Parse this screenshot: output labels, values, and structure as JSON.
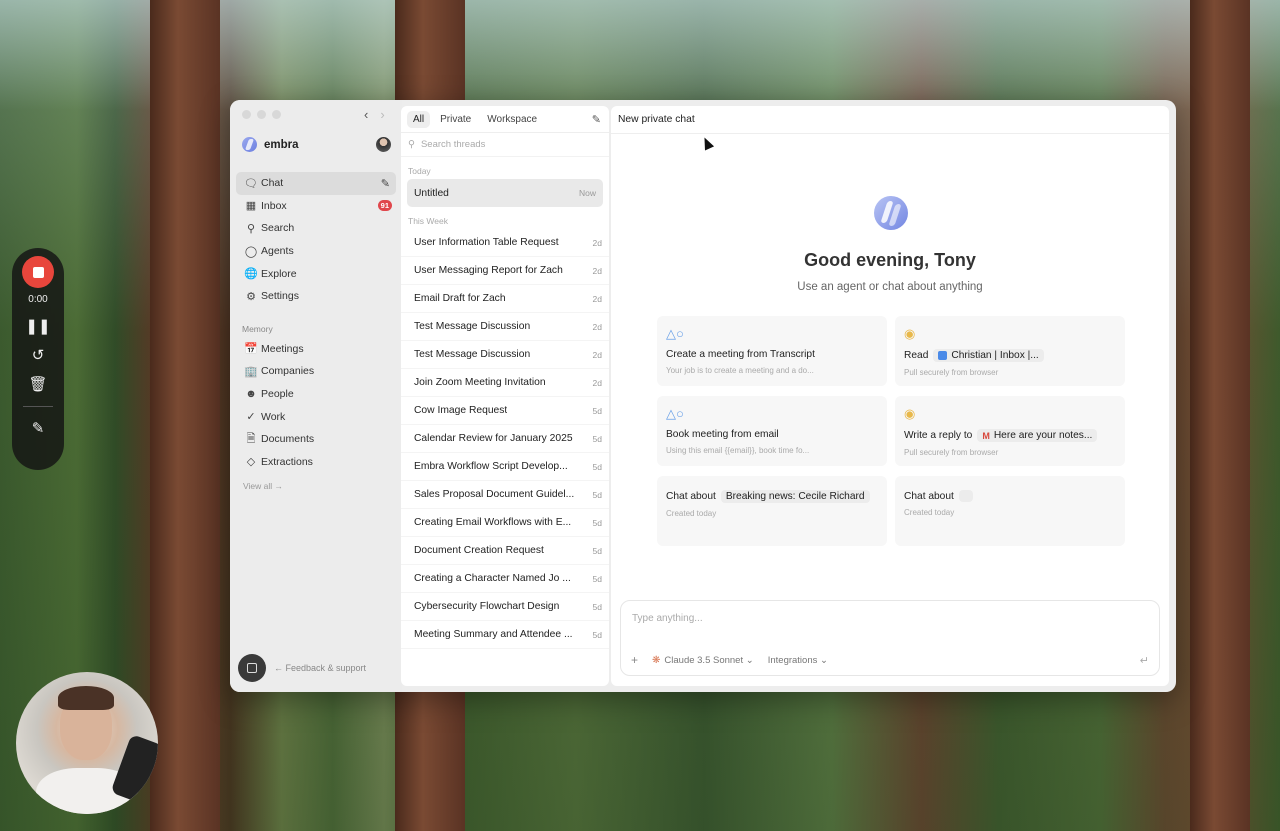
{
  "recorder": {
    "time": "0:00",
    "icons": [
      "stop-icon",
      "pause-icon",
      "restart-icon",
      "trash-icon",
      "pen-icon"
    ]
  },
  "sidebar": {
    "brand": "embra",
    "items": [
      {
        "label": "Chat",
        "icon": "chat-icon"
      },
      {
        "label": "Inbox",
        "icon": "inbox-icon",
        "badge": "91"
      },
      {
        "label": "Search",
        "icon": "search-icon"
      },
      {
        "label": "Agents",
        "icon": "agents-icon"
      },
      {
        "label": "Explore",
        "icon": "globe-icon"
      },
      {
        "label": "Settings",
        "icon": "gear-icon"
      }
    ],
    "memory_label": "Memory",
    "memory_items": [
      {
        "label": "Meetings",
        "icon": "calendar-icon"
      },
      {
        "label": "Companies",
        "icon": "building-icon"
      },
      {
        "label": "People",
        "icon": "person-icon"
      },
      {
        "label": "Work",
        "icon": "check-circle-icon"
      },
      {
        "label": "Documents",
        "icon": "document-icon"
      },
      {
        "label": "Extractions",
        "icon": "diamond-icon"
      }
    ],
    "view_all": "View all →",
    "feedback": "← Feedback & support"
  },
  "threads": {
    "tabs": [
      "All",
      "Private",
      "Workspace"
    ],
    "search_placeholder": "Search threads",
    "today_label": "Today",
    "today": [
      {
        "title": "Untitled",
        "time": "Now"
      }
    ],
    "week_label": "This Week",
    "week": [
      {
        "title": "User Information Table Request",
        "time": "2d"
      },
      {
        "title": "User Messaging Report for Zach",
        "time": "2d"
      },
      {
        "title": "Email Draft for Zach",
        "time": "2d"
      },
      {
        "title": "Test Message Discussion",
        "time": "2d"
      },
      {
        "title": "Test Message Discussion",
        "time": "2d"
      },
      {
        "title": "Join Zoom Meeting Invitation",
        "time": "2d"
      },
      {
        "title": "Cow Image Request",
        "time": "5d"
      },
      {
        "title": "Calendar Review for January 2025",
        "time": "5d"
      },
      {
        "title": "Embra Workflow Script Develop...",
        "time": "5d"
      },
      {
        "title": "Sales Proposal Document Guidel...",
        "time": "5d"
      },
      {
        "title": "Creating Email Workflows with E...",
        "time": "5d"
      },
      {
        "title": "Document Creation Request",
        "time": "5d"
      },
      {
        "title": "Creating a Character Named Jo ...",
        "time": "5d"
      },
      {
        "title": "Cybersecurity Flowchart Design",
        "time": "5d"
      },
      {
        "title": "Meeting Summary and Attendee ...",
        "time": "5d"
      }
    ]
  },
  "main": {
    "header": "New private chat",
    "greeting": "Good evening, Tony",
    "subtitle": "Use an agent or chat about anything",
    "cards": [
      {
        "prefix": "Create a meeting from Transcript",
        "chip": "",
        "sub": "Your job is to create a meeting and a do...",
        "icon": "agent-icon"
      },
      {
        "prefix": "Read",
        "chip": "Christian | Inbox |...",
        "sub": "Pull securely from browser",
        "icon": "chrome-icon"
      },
      {
        "prefix": "Book meeting from email",
        "chip": "",
        "sub": "Using this email {{email}}, book time fo...",
        "icon": "agent-icon"
      },
      {
        "prefix": "Write a reply to",
        "chip": "Here are your notes...",
        "sub": "Pull securely from browser",
        "icon": "chrome-icon"
      },
      {
        "prefix": "Chat about",
        "chip": "Breaking news: Cecile Richard",
        "sub": "Created today",
        "icon": ""
      },
      {
        "prefix": "Chat about",
        "chip": "",
        "sub": "Created today",
        "icon": ""
      }
    ],
    "composer": {
      "placeholder": "Type anything...",
      "model": "Claude 3.5 Sonnet",
      "integrations": "Integrations"
    }
  }
}
